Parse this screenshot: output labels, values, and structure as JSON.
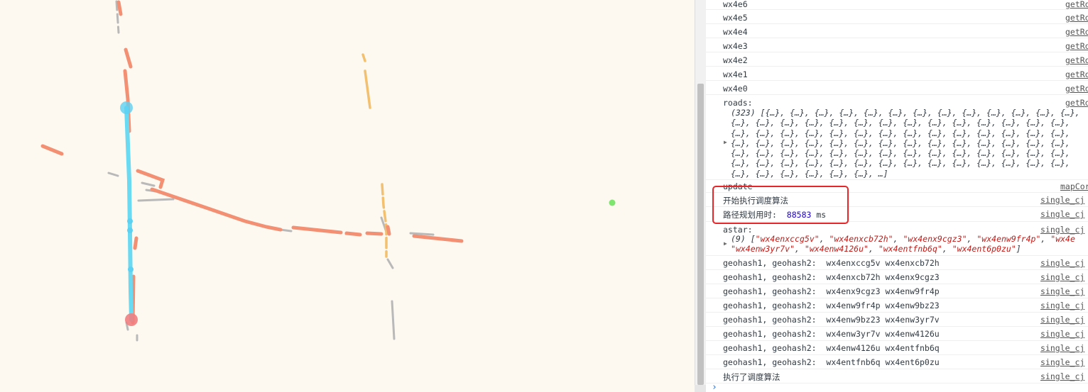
{
  "colors": {
    "map_bg": "#fdf9f1",
    "road_orange": "#f39073",
    "road_yellow": "#f2c06e",
    "road_gray": "#b9b9b9",
    "route_cyan": "#6ad9f2",
    "start_marker": "#5cd1f2",
    "end_marker": "#f07d80",
    "green_dot": "#7ee56f",
    "highlight_border": "#e8262a"
  },
  "console": {
    "geohash_rows": [
      {
        "text": "wx4e6",
        "src": "getRo"
      },
      {
        "text": "wx4e5",
        "src": "getRo"
      },
      {
        "text": "wx4e4",
        "src": "getRo"
      },
      {
        "text": "wx4e3",
        "src": "getRo"
      },
      {
        "text": "wx4e2",
        "src": "getRo"
      },
      {
        "text": "wx4e1",
        "src": "getRo"
      },
      {
        "text": "wx4e0",
        "src": "getRo"
      }
    ],
    "roads": {
      "label": "roads:",
      "src": "getRo",
      "lines": [
        "(323) [{…}, {…}, {…}, {…}, {…}, {…}, {…}, {…}, {…}, {…}, {…}, {…}, {…},",
        "{…}, {…}, {…}, {…}, {…}, {…}, {…}, {…}, {…}, {…}, {…}, {…}, {…}, {…},",
        "{…}, {…}, {…}, {…}, {…}, {…}, {…}, {…}, {…}, {…}, {…}, {…}, {…}, {…},",
        "{…}, {…}, {…}, {…}, {…}, {…}, {…}, {…}, {…}, {…}, {…}, {…}, {…}, {…},",
        "{…}, {…}, {…}, {…}, {…}, {…}, {…}, {…}, {…}, {…}, {…}, {…}, {…}, {…},",
        "{…}, {…}, {…}, {…}, {…}, {…}, {…}, {…}, {…}, {…}, {…}, {…}, {…}, {…},",
        "{…}, {…}, {…}, {…}, {…}, {…}, …]"
      ]
    },
    "update": {
      "text": "update",
      "src": "mapCor"
    },
    "start_algo": {
      "text": "开始执行调度算法",
      "src": "single_cj"
    },
    "route_time": {
      "label": "路径规划用时:",
      "value": "88583",
      "unit": "ms",
      "src": "single_cj"
    },
    "astar": {
      "label": "astar:",
      "src": "single_cj",
      "count": "(9)",
      "items": [
        "wx4enxccg5v",
        "wx4enxcb72h",
        "wx4enx9cgz3",
        "wx4enw9fr4p",
        "wx4e",
        "wx4enw3yr7v",
        "wx4enw4126u",
        "wx4entfnb6q",
        "wx4ent6p0zu"
      ]
    },
    "pairs_label": "geohash1, geohash2:",
    "pairs": [
      {
        "a": "wx4enxccg5v",
        "b": "wx4enxcb72h",
        "src": "single_cj"
      },
      {
        "a": "wx4enxcb72h",
        "b": "wx4enx9cgz3",
        "src": "single_cj"
      },
      {
        "a": "wx4enx9cgz3",
        "b": "wx4enw9fr4p",
        "src": "single_cj"
      },
      {
        "a": "wx4enw9fr4p",
        "b": "wx4enw9bz23",
        "src": "single_cj"
      },
      {
        "a": "wx4enw9bz23",
        "b": "wx4enw3yr7v",
        "src": "single_cj"
      },
      {
        "a": "wx4enw3yr7v",
        "b": "wx4enw4126u",
        "src": "single_cj"
      },
      {
        "a": "wx4enw4126u",
        "b": "wx4entfnb6q",
        "src": "single_cj"
      },
      {
        "a": "wx4entfnb6q",
        "b": "wx4ent6p0zu",
        "src": "single_cj"
      }
    ],
    "done": {
      "text": "执行了调度算法",
      "src": "single_cj"
    },
    "prompt": "›"
  }
}
